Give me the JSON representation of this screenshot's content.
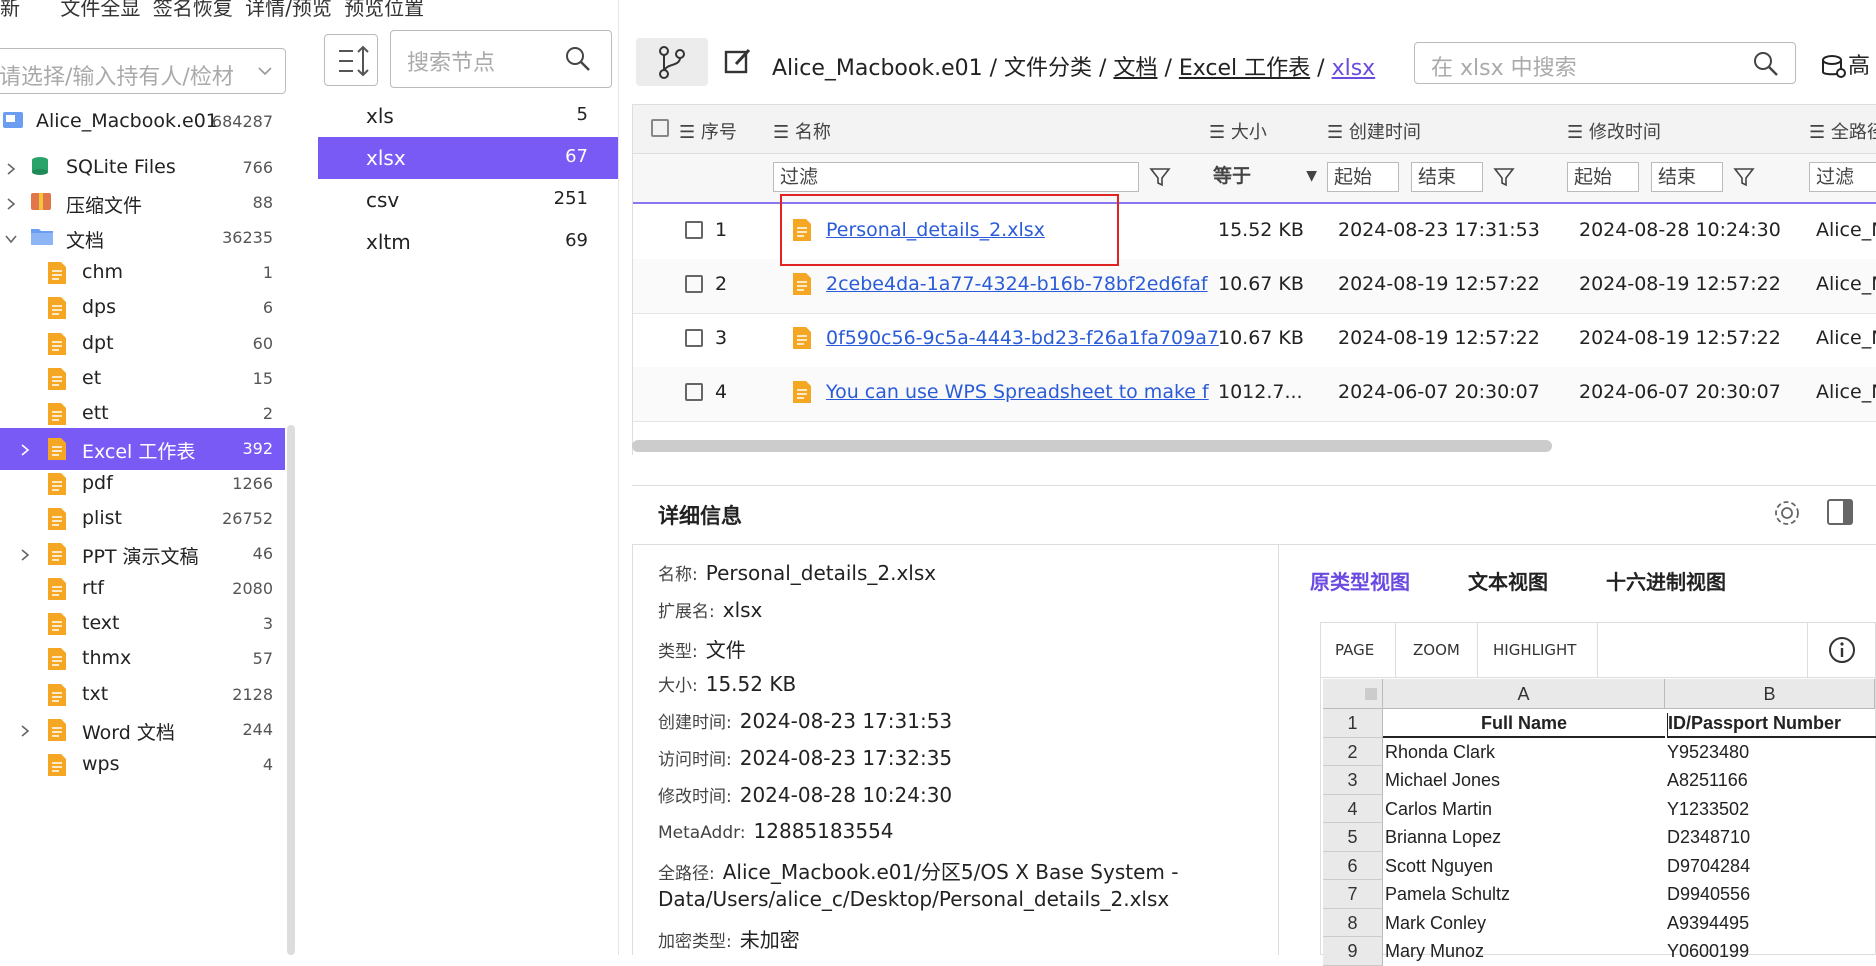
{
  "menu": [
    "新",
    "文件全显",
    "签名恢复",
    "详情/预览",
    "预览位置"
  ],
  "owner_select": {
    "placeholder": "请选择/输入持有人/检材"
  },
  "tree": [
    {
      "label": "Alice_Macbook.e01",
      "count": "684287",
      "icon": "disk-icon"
    },
    {
      "label": "SQLite Files",
      "count": "766",
      "icon": "database-icon"
    },
    {
      "label": "压缩文件",
      "count": "88",
      "icon": "archive-icon"
    },
    {
      "label": "文档",
      "count": "36235",
      "icon": "folder-icon"
    },
    {
      "label": "chm",
      "count": "1",
      "icon": "doc-icon"
    },
    {
      "label": "dps",
      "count": "6",
      "icon": "doc-icon"
    },
    {
      "label": "dpt",
      "count": "60",
      "icon": "doc-icon"
    },
    {
      "label": "et",
      "count": "15",
      "icon": "doc-icon"
    },
    {
      "label": "ett",
      "count": "2",
      "icon": "doc-icon"
    },
    {
      "label": "Excel 工作表",
      "count": "392",
      "icon": "doc-icon"
    },
    {
      "label": "pdf",
      "count": "1266",
      "icon": "doc-icon"
    },
    {
      "label": "plist",
      "count": "26752",
      "icon": "doc-icon"
    },
    {
      "label": "PPT 演示文稿",
      "count": "46",
      "icon": "doc-icon"
    },
    {
      "label": "rtf",
      "count": "2080",
      "icon": "doc-icon"
    },
    {
      "label": "text",
      "count": "3",
      "icon": "doc-icon"
    },
    {
      "label": "thmx",
      "count": "57",
      "icon": "doc-icon"
    },
    {
      "label": "txt",
      "count": "2128",
      "icon": "doc-icon"
    },
    {
      "label": "Word 文档",
      "count": "244",
      "icon": "doc-icon"
    },
    {
      "label": "wps",
      "count": "4",
      "icon": "doc-icon"
    }
  ],
  "node_search": {
    "placeholder": "搜索节点"
  },
  "extensions": [
    {
      "label": "xls",
      "count": "5"
    },
    {
      "label": "xlsx",
      "count": "67"
    },
    {
      "label": "csv",
      "count": "251"
    },
    {
      "label": "xltm",
      "count": "69"
    }
  ],
  "breadcrumb": {
    "p1": "Alice_Macbook.e01",
    "p2": "文件分类",
    "p3": "文档",
    "p4": "Excel 工作表",
    "p5": "xlsx",
    "sep": " / "
  },
  "xsearch": {
    "placeholder": "在 xlsx 中搜索"
  },
  "advanced_label": "高",
  "table": {
    "headers": {
      "index": "序号",
      "name": "名称",
      "size": "大小",
      "created": "创建时间",
      "modified": "修改时间",
      "path": "全路径"
    },
    "filters": {
      "name": "过滤",
      "size": "等于",
      "start": "起始",
      "end": "结束",
      "path": "过滤"
    },
    "rows": [
      {
        "num": "1",
        "name": "Personal_details_2.xlsx",
        "size": "15.52 KB",
        "created": "2024-08-23 17:31:53",
        "modified": "2024-08-28 10:24:30",
        "path": "Alice_M"
      },
      {
        "num": "2",
        "name": "2cebe4da-1a77-4324-b16b-78bf2ed6faf",
        "size": "10.67 KB",
        "created": "2024-08-19 12:57:22",
        "modified": "2024-08-19 12:57:22",
        "path": "Alice_M"
      },
      {
        "num": "3",
        "name": "0f590c56-9c5a-4443-bd23-f26a1fa709a7",
        "size": "10.67 KB",
        "created": "2024-08-19 12:57:22",
        "modified": "2024-08-19 12:57:22",
        "path": "Alice_M"
      },
      {
        "num": "4",
        "name": "You can use WPS Spreadsheet to make f",
        "size": "1012.7...",
        "created": "2024-06-07 20:30:07",
        "modified": "2024-06-07 20:30:07",
        "path": "Alice_M"
      }
    ]
  },
  "detail": {
    "title": "详细信息",
    "name_k": "名称:",
    "name_v": "Personal_details_2.xlsx",
    "ext_k": "扩展名:",
    "ext_v": "xlsx",
    "type_k": "类型:",
    "type_v": "文件",
    "size_k": "大小:",
    "size_v": "15.52 KB",
    "ctime_k": "创建时间:",
    "ctime_v": "2024-08-23 17:31:53",
    "atime_k": "访问时间:",
    "atime_v": "2024-08-23 17:32:35",
    "mtime_k": "修改时间:",
    "mtime_v": "2024-08-28 10:24:30",
    "meta_k": "MetaAddr:",
    "meta_v": "12885183554",
    "path_k": "全路径:",
    "path_v1": "Alice_Macbook.e01/分区5/OS X Base System -",
    "path_v2": "Data/Users/alice_c/Desktop/Personal_details_2.xlsx",
    "enc_k": "加密类型:",
    "enc_v": "未加密"
  },
  "preview_tabs": {
    "raw": "原类型视图",
    "text": "文本视图",
    "hex": "十六进制视图"
  },
  "viewer_toolbar": {
    "page": "PAGE",
    "zoom": "ZOOM",
    "highlight": "HIGHLIGHT"
  },
  "sheet": {
    "col_a": "A",
    "col_b": "B",
    "header_a": "Full Name",
    "header_b": "ID/Passport Number",
    "rows": [
      {
        "r": "1"
      },
      {
        "r": "2",
        "a": "Rhonda Clark",
        "b": "Y9523480"
      },
      {
        "r": "3",
        "a": "Michael Jones",
        "b": "A8251166"
      },
      {
        "r": "4",
        "a": "Carlos Martin",
        "b": "Y1233502"
      },
      {
        "r": "5",
        "a": "Brianna Lopez",
        "b": "D2348710"
      },
      {
        "r": "6",
        "a": "Scott Nguyen",
        "b": "D9704284"
      },
      {
        "r": "7",
        "a": "Pamela Schultz",
        "b": "D9940556"
      },
      {
        "r": "8",
        "a": "Mark Conley",
        "b": "A9394495"
      },
      {
        "r": "9",
        "a": "Mary Munoz",
        "b": "Y0600199"
      }
    ]
  },
  "colors": {
    "accent": "#7a5af5",
    "link": "#2a5bd8",
    "highlight_box": "#e02424"
  }
}
